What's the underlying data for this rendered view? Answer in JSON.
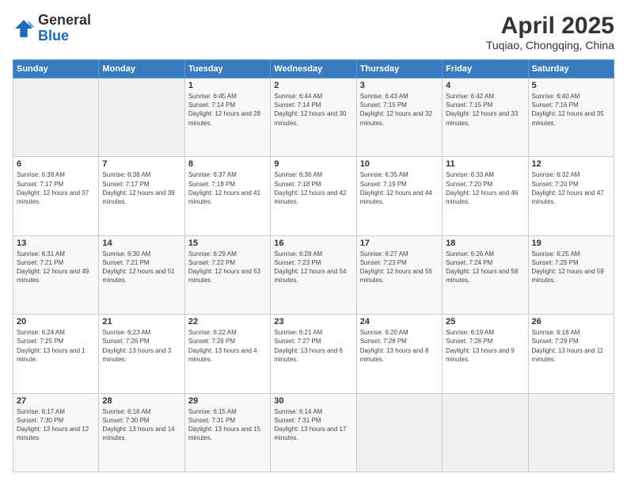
{
  "header": {
    "logo_general": "General",
    "logo_blue": "Blue",
    "title": "April 2025",
    "subtitle": "Tuqiao, Chongqing, China"
  },
  "columns": [
    "Sunday",
    "Monday",
    "Tuesday",
    "Wednesday",
    "Thursday",
    "Friday",
    "Saturday"
  ],
  "weeks": [
    [
      {
        "day": "",
        "info": ""
      },
      {
        "day": "",
        "info": ""
      },
      {
        "day": "1",
        "info": "Sunrise: 6:45 AM\nSunset: 7:14 PM\nDaylight: 12 hours and 28 minutes."
      },
      {
        "day": "2",
        "info": "Sunrise: 6:44 AM\nSunset: 7:14 PM\nDaylight: 12 hours and 30 minutes."
      },
      {
        "day": "3",
        "info": "Sunrise: 6:43 AM\nSunset: 7:15 PM\nDaylight: 12 hours and 32 minutes."
      },
      {
        "day": "4",
        "info": "Sunrise: 6:42 AM\nSunset: 7:15 PM\nDaylight: 12 hours and 33 minutes."
      },
      {
        "day": "5",
        "info": "Sunrise: 6:40 AM\nSunset: 7:16 PM\nDaylight: 12 hours and 35 minutes."
      }
    ],
    [
      {
        "day": "6",
        "info": "Sunrise: 6:39 AM\nSunset: 7:17 PM\nDaylight: 12 hours and 37 minutes."
      },
      {
        "day": "7",
        "info": "Sunrise: 6:38 AM\nSunset: 7:17 PM\nDaylight: 12 hours and 39 minutes."
      },
      {
        "day": "8",
        "info": "Sunrise: 6:37 AM\nSunset: 7:18 PM\nDaylight: 12 hours and 41 minutes."
      },
      {
        "day": "9",
        "info": "Sunrise: 6:36 AM\nSunset: 7:18 PM\nDaylight: 12 hours and 42 minutes."
      },
      {
        "day": "10",
        "info": "Sunrise: 6:35 AM\nSunset: 7:19 PM\nDaylight: 12 hours and 44 minutes."
      },
      {
        "day": "11",
        "info": "Sunrise: 6:33 AM\nSunset: 7:20 PM\nDaylight: 12 hours and 46 minutes."
      },
      {
        "day": "12",
        "info": "Sunrise: 6:32 AM\nSunset: 7:20 PM\nDaylight: 12 hours and 47 minutes."
      }
    ],
    [
      {
        "day": "13",
        "info": "Sunrise: 6:31 AM\nSunset: 7:21 PM\nDaylight: 12 hours and 49 minutes."
      },
      {
        "day": "14",
        "info": "Sunrise: 6:30 AM\nSunset: 7:21 PM\nDaylight: 12 hours and 51 minutes."
      },
      {
        "day": "15",
        "info": "Sunrise: 6:29 AM\nSunset: 7:22 PM\nDaylight: 12 hours and 53 minutes."
      },
      {
        "day": "16",
        "info": "Sunrise: 6:28 AM\nSunset: 7:23 PM\nDaylight: 12 hours and 54 minutes."
      },
      {
        "day": "17",
        "info": "Sunrise: 6:27 AM\nSunset: 7:23 PM\nDaylight: 12 hours and 56 minutes."
      },
      {
        "day": "18",
        "info": "Sunrise: 6:26 AM\nSunset: 7:24 PM\nDaylight: 12 hours and 58 minutes."
      },
      {
        "day": "19",
        "info": "Sunrise: 6:25 AM\nSunset: 7:25 PM\nDaylight: 12 hours and 59 minutes."
      }
    ],
    [
      {
        "day": "20",
        "info": "Sunrise: 6:24 AM\nSunset: 7:25 PM\nDaylight: 13 hours and 1 minute."
      },
      {
        "day": "21",
        "info": "Sunrise: 6:23 AM\nSunset: 7:26 PM\nDaylight: 13 hours and 3 minutes."
      },
      {
        "day": "22",
        "info": "Sunrise: 6:22 AM\nSunset: 7:26 PM\nDaylight: 13 hours and 4 minutes."
      },
      {
        "day": "23",
        "info": "Sunrise: 6:21 AM\nSunset: 7:27 PM\nDaylight: 13 hours and 6 minutes."
      },
      {
        "day": "24",
        "info": "Sunrise: 6:20 AM\nSunset: 7:28 PM\nDaylight: 13 hours and 8 minutes."
      },
      {
        "day": "25",
        "info": "Sunrise: 6:19 AM\nSunset: 7:28 PM\nDaylight: 13 hours and 9 minutes."
      },
      {
        "day": "26",
        "info": "Sunrise: 6:18 AM\nSunset: 7:29 PM\nDaylight: 13 hours and 11 minutes."
      }
    ],
    [
      {
        "day": "27",
        "info": "Sunrise: 6:17 AM\nSunset: 7:30 PM\nDaylight: 13 hours and 12 minutes."
      },
      {
        "day": "28",
        "info": "Sunrise: 6:16 AM\nSunset: 7:30 PM\nDaylight: 13 hours and 14 minutes."
      },
      {
        "day": "29",
        "info": "Sunrise: 6:15 AM\nSunset: 7:31 PM\nDaylight: 13 hours and 15 minutes."
      },
      {
        "day": "30",
        "info": "Sunrise: 6:14 AM\nSunset: 7:31 PM\nDaylight: 13 hours and 17 minutes."
      },
      {
        "day": "",
        "info": ""
      },
      {
        "day": "",
        "info": ""
      },
      {
        "day": "",
        "info": ""
      }
    ]
  ]
}
